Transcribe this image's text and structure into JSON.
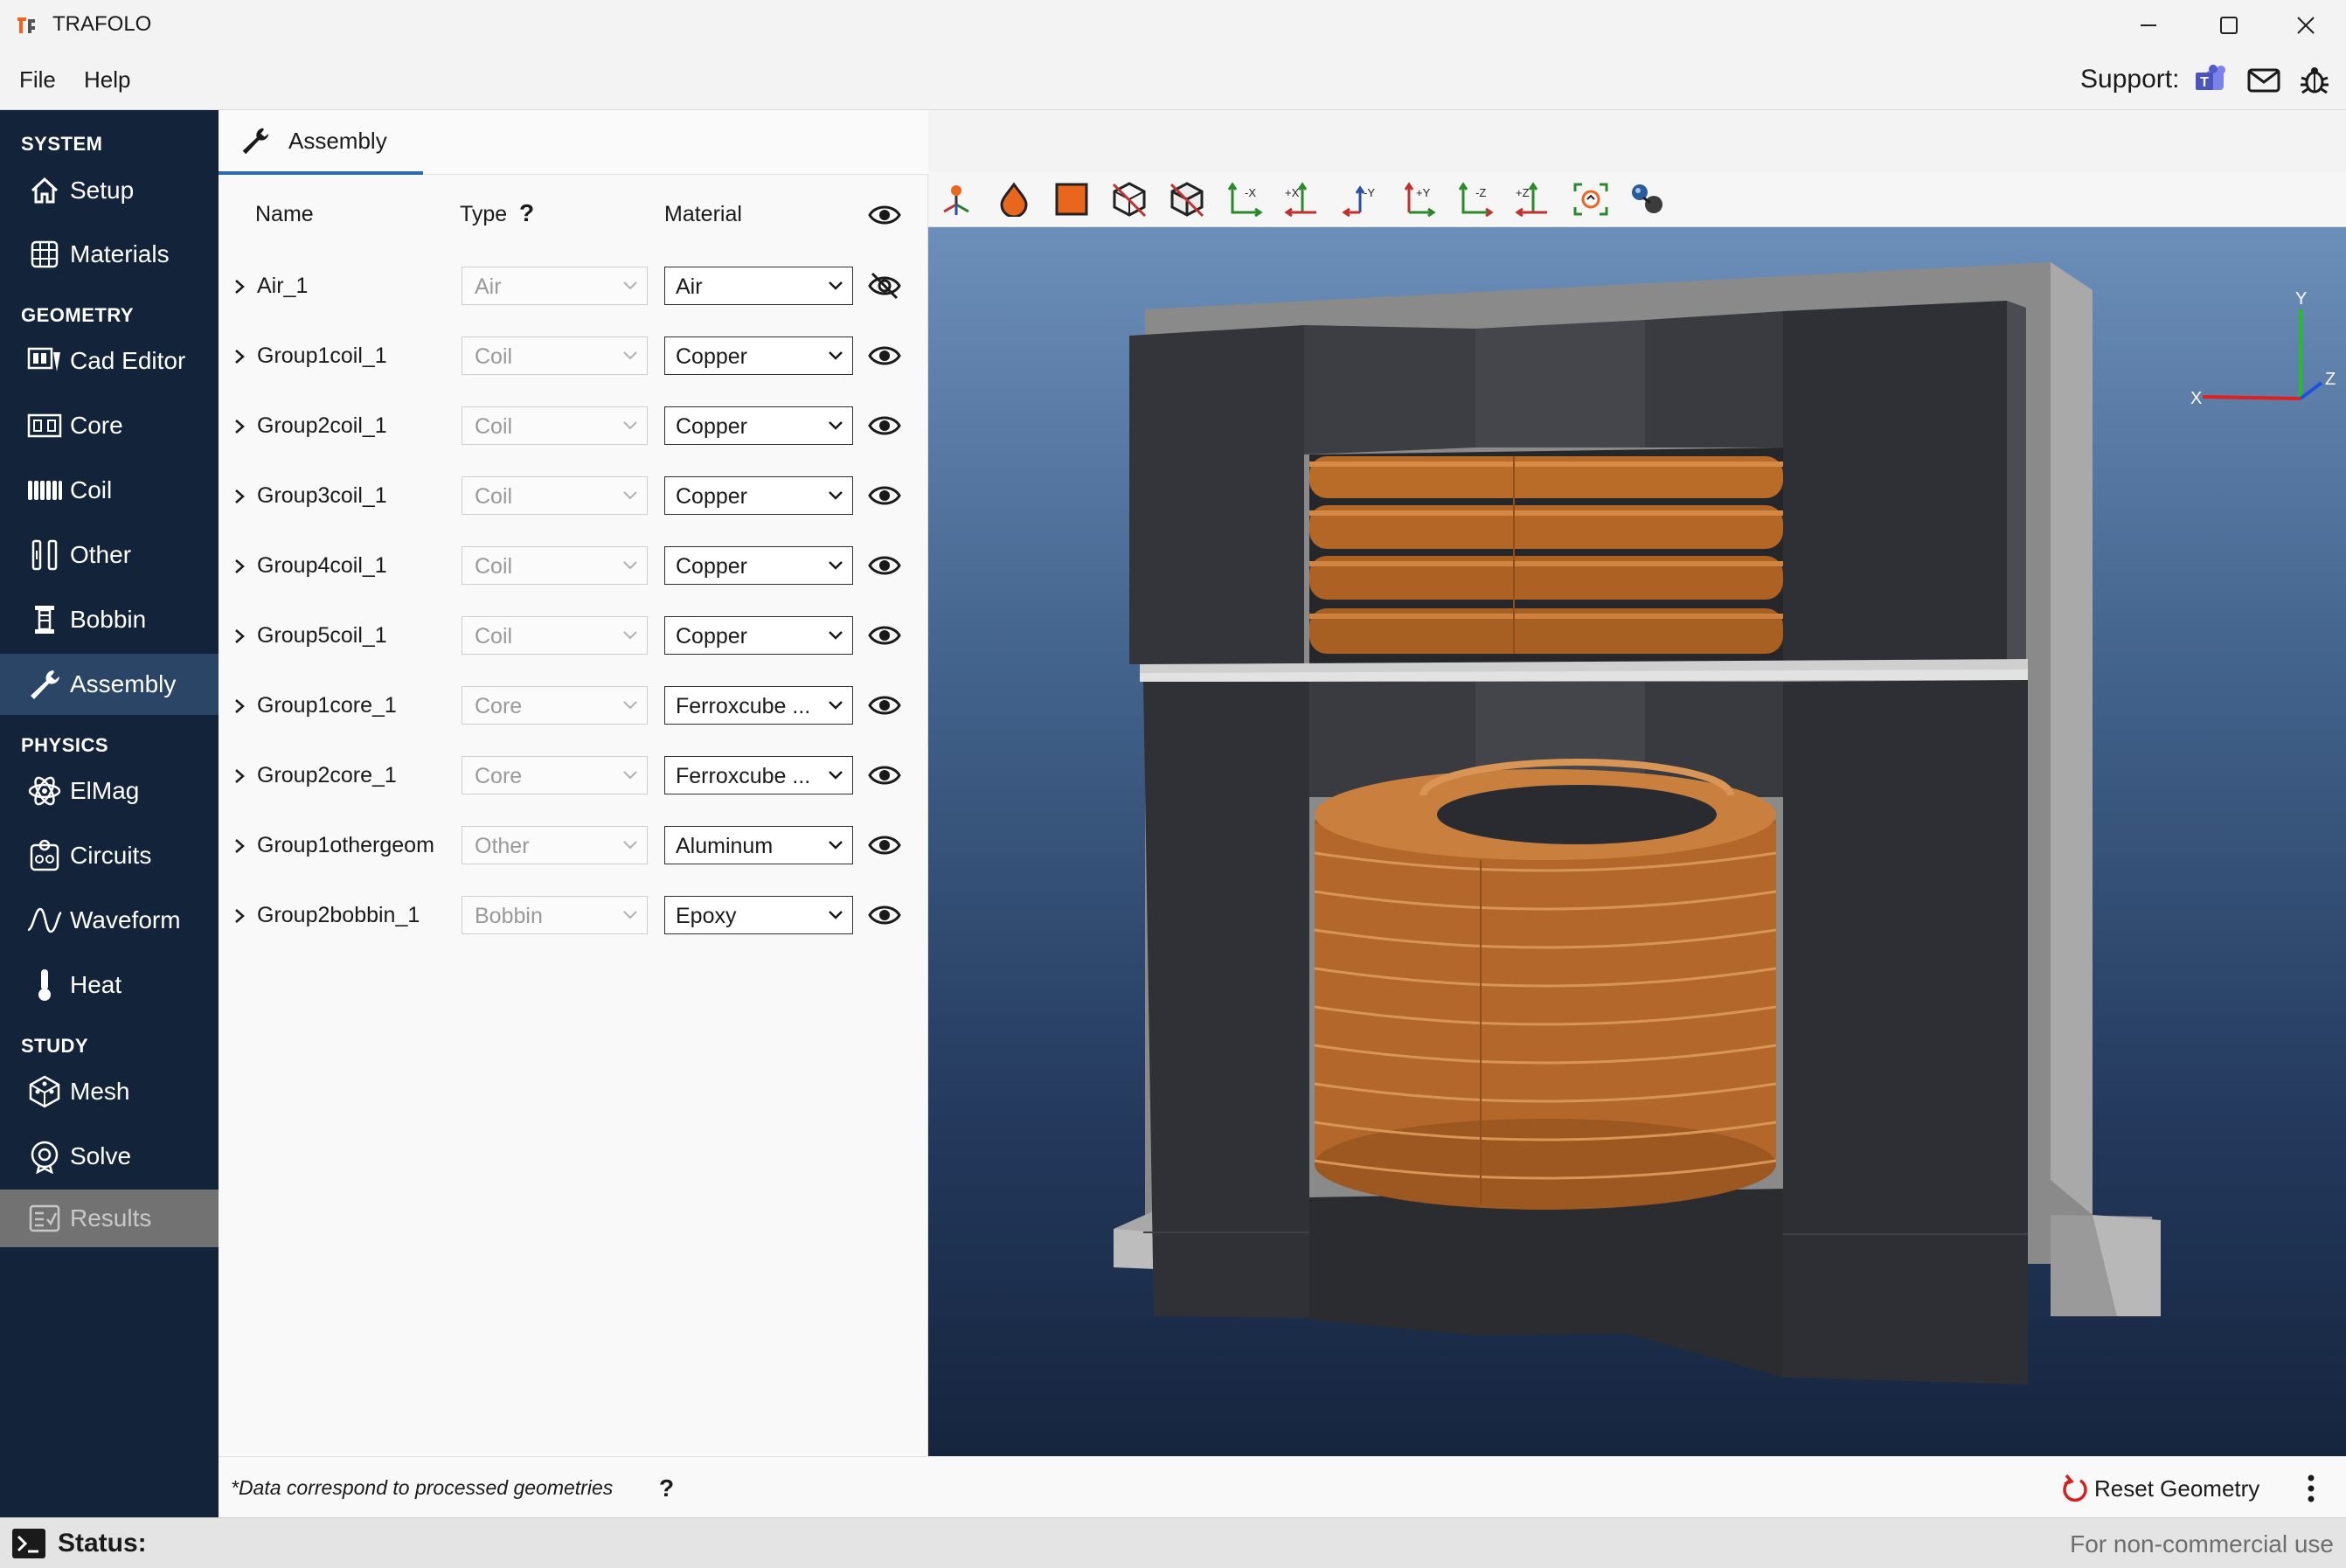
{
  "window": {
    "title": "TRAFOLO",
    "minimize_icon": "minimize-icon",
    "maximize_icon": "maximize-icon",
    "close_icon": "close-icon"
  },
  "menu": {
    "file": "File",
    "help": "Help",
    "support_label": "Support:",
    "support_icons": [
      "teams-icon",
      "mail-icon",
      "bug-icon"
    ]
  },
  "sidebar": {
    "sections": [
      {
        "label": "SYSTEM",
        "items": [
          {
            "label": "Setup",
            "icon": "home-icon"
          },
          {
            "label": "Materials",
            "icon": "grid-icon"
          }
        ]
      },
      {
        "label": "GEOMETRY",
        "items": [
          {
            "label": "Cad Editor",
            "icon": "cad-icon"
          },
          {
            "label": "Core",
            "icon": "core-icon"
          },
          {
            "label": "Coil",
            "icon": "coil-icon"
          },
          {
            "label": "Other",
            "icon": "other-icon"
          },
          {
            "label": "Bobbin",
            "icon": "bobbin-icon"
          },
          {
            "label": "Assembly",
            "icon": "wrench-icon"
          }
        ]
      },
      {
        "label": "PHYSICS",
        "items": [
          {
            "label": "ElMag",
            "icon": "atom-icon"
          },
          {
            "label": "Circuits",
            "icon": "circuit-icon"
          },
          {
            "label": "Waveform",
            "icon": "wave-icon"
          },
          {
            "label": "Heat",
            "icon": "thermometer-icon"
          }
        ]
      },
      {
        "label": "STUDY",
        "items": [
          {
            "label": "Mesh",
            "icon": "mesh-icon"
          },
          {
            "label": "Solve",
            "icon": "solve-icon"
          },
          {
            "label": "Results",
            "icon": "results-icon"
          }
        ]
      }
    ],
    "active_item": "Assembly",
    "disabled_item": "Results"
  },
  "panel": {
    "tab_label": "Assembly",
    "columns": {
      "name": "Name",
      "type": "Type",
      "type_help": "?",
      "material": "Material"
    },
    "rows": [
      {
        "name": "Air_1",
        "type": "Air",
        "material": "Air",
        "visible": false
      },
      {
        "name": "Group1coil_1",
        "type": "Coil",
        "material": "Copper",
        "visible": true
      },
      {
        "name": "Group2coil_1",
        "type": "Coil",
        "material": "Copper",
        "visible": true
      },
      {
        "name": "Group3coil_1",
        "type": "Coil",
        "material": "Copper",
        "visible": true
      },
      {
        "name": "Group4coil_1",
        "type": "Coil",
        "material": "Copper",
        "visible": true
      },
      {
        "name": "Group5coil_1",
        "type": "Coil",
        "material": "Copper",
        "visible": true
      },
      {
        "name": "Group1core_1",
        "type": "Core",
        "material": "Ferroxcube ...",
        "visible": true
      },
      {
        "name": "Group2core_1",
        "type": "Core",
        "material": "Ferroxcube ...",
        "visible": true
      },
      {
        "name": "Group1othergeom",
        "type": "Other",
        "material": "Aluminum",
        "visible": true
      },
      {
        "name": "Group2bobbin_1",
        "type": "Bobbin",
        "material": "Epoxy",
        "visible": true
      }
    ]
  },
  "footer": {
    "note": "*Data correspond to processed geometries",
    "note_help": "?",
    "reset_label": "Reset Geometry"
  },
  "status": {
    "label": "Status:",
    "license": "For non-commercial use"
  },
  "viewer": {
    "toolbar_icons": [
      "pick-icon",
      "drop-icon",
      "solid-icon",
      "wireframe-icon",
      "box-icon",
      "view-minus-x-icon",
      "view-plus-x-icon",
      "view-minus-y-icon",
      "view-plus-y-icon",
      "view-minus-z-icon",
      "view-plus-z-icon",
      "fit-view-icon",
      "lighting-icon"
    ],
    "toolbar_labels": [
      "-X",
      "+X",
      "-Y",
      "+Y",
      "-Z",
      "+Z"
    ],
    "axes": {
      "x": "X",
      "y": "Y",
      "z": "Z"
    },
    "colors": {
      "core": "#35353a",
      "copper": "#b86a28",
      "frame": "#8c8c8c",
      "accent": "#2d6bb0"
    }
  }
}
